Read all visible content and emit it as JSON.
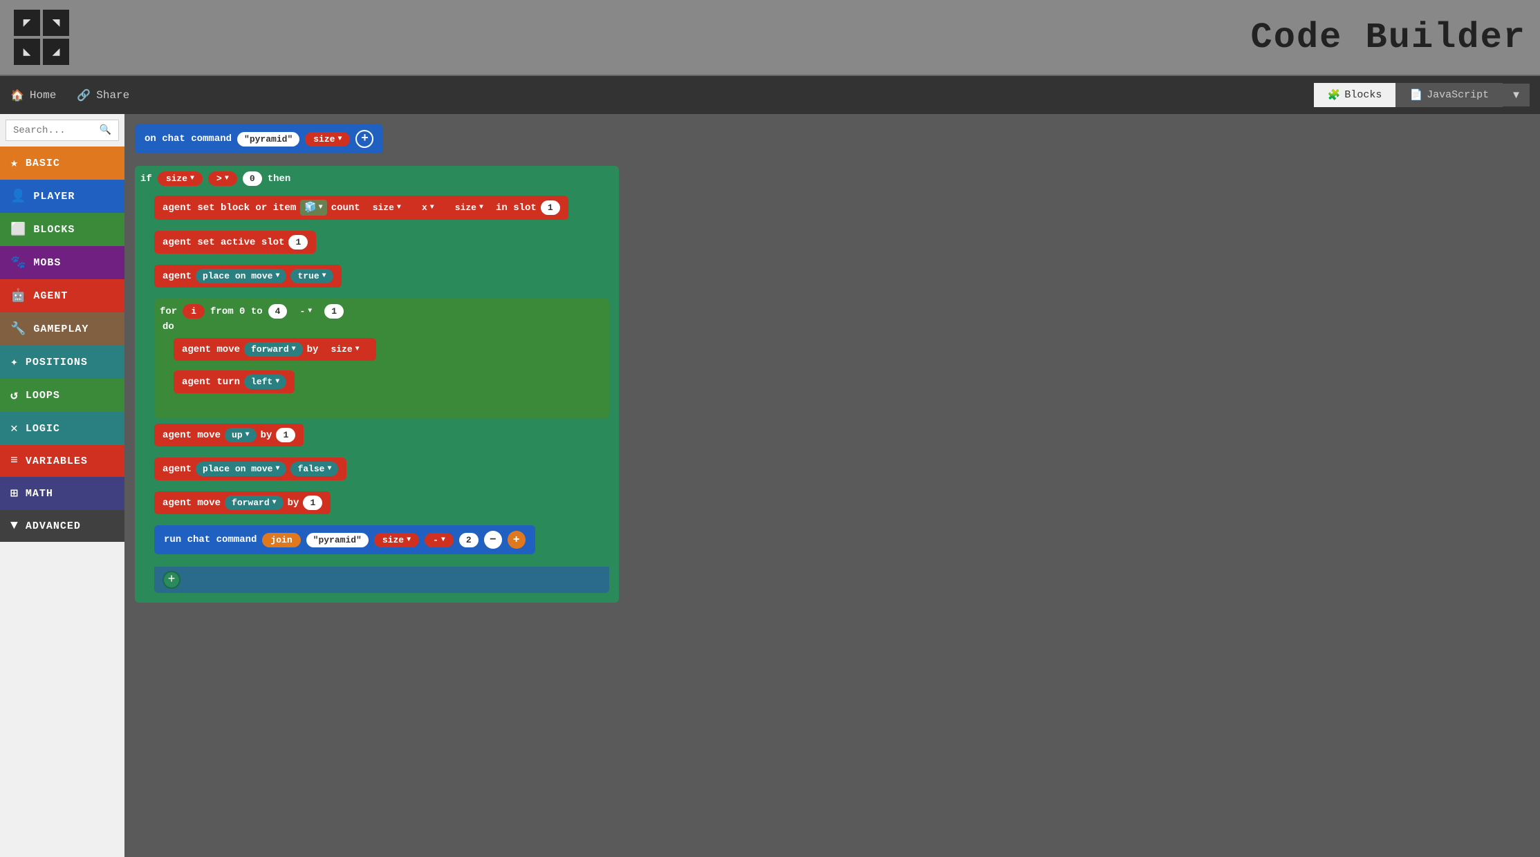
{
  "header": {
    "title": "Code Builder",
    "logo_cells": [
      "↖",
      "↗",
      "↙",
      "↘"
    ]
  },
  "navbar": {
    "home_label": "Home",
    "share_label": "Share",
    "blocks_label": "Blocks",
    "js_label": "JavaScript"
  },
  "sidebar": {
    "search_placeholder": "Search...",
    "items": [
      {
        "label": "BASIC",
        "color": "#e07820",
        "icon": "★"
      },
      {
        "label": "PLAYER",
        "color": "#2060c0",
        "icon": "👤"
      },
      {
        "label": "BLOCKS",
        "color": "#3a8a3a",
        "icon": "⬜"
      },
      {
        "label": "MOBS",
        "color": "#702080",
        "icon": "🐾"
      },
      {
        "label": "AGENT",
        "color": "#d03020",
        "icon": "🤖"
      },
      {
        "label": "GAMEPLAY",
        "color": "#806040",
        "icon": "🔧"
      },
      {
        "label": "POSITIONS",
        "color": "#2a8080",
        "icon": "✦"
      },
      {
        "label": "LOOPS",
        "color": "#3a8a3a",
        "icon": "↺"
      },
      {
        "label": "LOGIC",
        "color": "#2a8080",
        "icon": "✕"
      },
      {
        "label": "VARIABLES",
        "color": "#d03020",
        "icon": "≡"
      },
      {
        "label": "MATH",
        "color": "#404080",
        "icon": "⊞"
      },
      {
        "label": "ADVANCED",
        "color": "#404040",
        "icon": "▼"
      }
    ]
  },
  "code_blocks": {
    "chat_command": {
      "prefix": "on chat command",
      "command": "\"pyramid\"",
      "param": "size"
    },
    "if_condition": {
      "keyword_if": "if",
      "var_size": "size",
      "operator": ">",
      "value": "0",
      "keyword_then": "then"
    },
    "agent_set_block": {
      "text": "agent set block or item",
      "count": "count",
      "x_label": "x",
      "in_slot": "in slot",
      "slot_val": "1"
    },
    "agent_set_slot": {
      "text": "agent set active slot",
      "val": "1"
    },
    "agent_place_on_move_1": {
      "text1": "agent",
      "text2": "place on move",
      "value": "true"
    },
    "for_loop": {
      "keyword_for": "for",
      "var": "i",
      "from_text": "from 0 to",
      "end_val": "4",
      "step_val": "1",
      "keyword_do": "do"
    },
    "agent_move_forward": {
      "text1": "agent move",
      "dir": "forward",
      "by": "by",
      "amount": "size"
    },
    "agent_turn": {
      "text1": "agent turn",
      "dir": "left"
    },
    "agent_move_up": {
      "text1": "agent move",
      "dir": "up",
      "by": "by",
      "amount": "1"
    },
    "agent_place_on_move_2": {
      "text1": "agent",
      "text2": "place on move",
      "value": "false"
    },
    "agent_move_forward_2": {
      "text1": "agent move",
      "dir": "forward",
      "by": "by",
      "amount": "1"
    },
    "run_chat": {
      "text": "run chat command",
      "join": "join",
      "str_val": "\"pyramid\"",
      "var": "size",
      "op": "-",
      "num": "2"
    }
  }
}
